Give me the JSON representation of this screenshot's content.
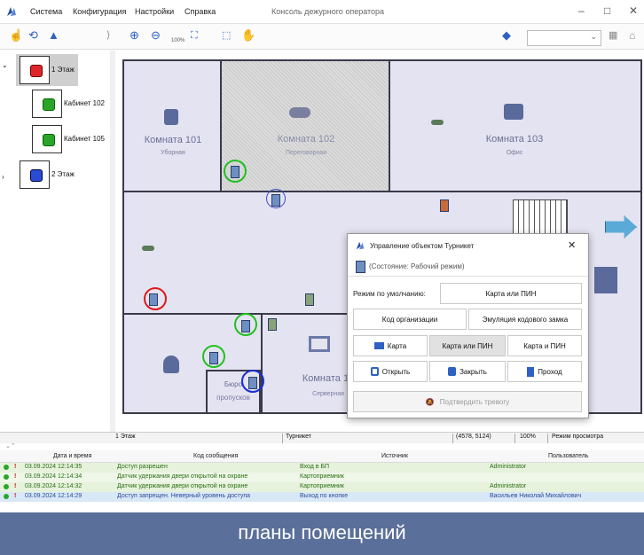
{
  "app": {
    "menu": [
      "Система",
      "Конфигурация",
      "Настройки",
      "Справка"
    ],
    "window_title": "Консоль дежурного оператора",
    "minimize": "–",
    "maximize": "□",
    "close": "✕"
  },
  "toolbar": {
    "zoom_label": "100%",
    "layers_combo_value": ""
  },
  "tree": {
    "items": [
      {
        "label": "1 Этаж",
        "color": "#e0262a"
      },
      {
        "label": "Кабинет 102",
        "color": "#2aa52a"
      },
      {
        "label": "Кабинет 105",
        "color": "#2aa52a"
      },
      {
        "label": "2 Этаж",
        "color": "#2a4bd6"
      }
    ]
  },
  "plan": {
    "rooms": [
      {
        "name": "Комната 101",
        "sub": "Уборная"
      },
      {
        "name": "Комната 102",
        "sub": "Переговорная"
      },
      {
        "name": "Комната 103",
        "sub": "Офис"
      },
      {
        "name": "Комната 10",
        "sub": "Серверная"
      },
      {
        "name": "Бюро",
        "sub": "пропусков"
      }
    ]
  },
  "dialog": {
    "title": "Управление объектом Турникет",
    "state": "(Состояние:  Рабочий режим)",
    "default_mode_label": "Режим по умолчанию:",
    "default_mode_value": "Карта или ПИН",
    "org_code": "Код организации",
    "emulation": "Эмуляция кодового замка",
    "mode_card": "Карта",
    "mode_card_or_pin": "Карта или ПИН",
    "mode_card_and_pin": "Карта и ПИН",
    "open": "Открыть",
    "close": "Закрыть",
    "pass": "Проход",
    "confirm_alarm": "Подтвердить тревогу",
    "close_x": "✕"
  },
  "status": {
    "floor": "1 Этаж",
    "object": "Турникет",
    "coords": "(4578, 5124)",
    "zoom": "100%",
    "mode": "Режим просмотра"
  },
  "log": {
    "columns": [
      "Дата и время",
      "Код сообщения",
      "Источник",
      "Пользователь"
    ],
    "rows": [
      {
        "time": "03.09.2024 12:14:35",
        "message": "Доступ разрешен",
        "source": "Вход в БП",
        "user": "Administrator",
        "bg": "#e6f2dc",
        "color": "#2b6e13"
      },
      {
        "time": "03.09.2024 12:14:34",
        "message": "Датчик удержания двери открытой на охране",
        "source": "Картоприемник",
        "user": "",
        "bg": "#eef7e8",
        "color": "#2b6e13"
      },
      {
        "time": "03.09.2024 12:14:32",
        "message": "Датчик удержания двери открытой на охране",
        "source": "Картоприемник",
        "user": "Administrator",
        "bg": "#e6f2dc",
        "color": "#2b6e13"
      },
      {
        "time": "03.09.2024 12:14:29",
        "message": "Доступ запрещен. Неверный уровень доступа",
        "source": "Выход по кнопке",
        "user": "Васильев Николай Михайлович",
        "bg": "#d9e8f6",
        "color": "#2b4a9a"
      }
    ]
  },
  "caption": "планы помещений"
}
